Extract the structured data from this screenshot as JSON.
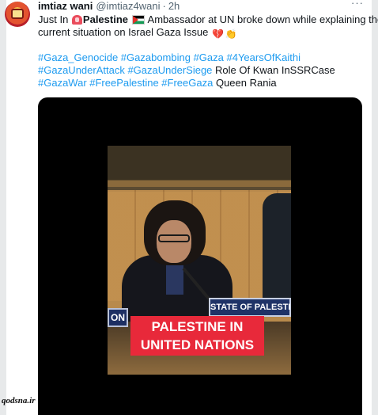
{
  "tweet": {
    "display_name": "imtiaz wani",
    "handle": "@imtiaz4wani",
    "separator": "·",
    "time": "2h",
    "more_label": "···",
    "line1_prefix": "Just In ",
    "line1_bold": "Palestine",
    "line1_suffix": " Ambassador at UN broke down while explaining the",
    "line2": "current situation on Israel Gaza Issue ",
    "hashtags_line1": "#Gaza_Genocide #Gazabombing #Gaza #4YearsOfKaithi",
    "hashtags_line2_tags": "#GazaUnderAttack #GazaUnderSiege",
    "hashtags_line2_text": " Role Of Kwan InSSRCase",
    "hashtags_line3_tags": "#GazaWar #FreePalestine #FreeGaza",
    "hashtags_line3_text": " Queen Rania",
    "hashtag_color": "#1d9bf0"
  },
  "icons": {
    "avatar": "profile-avatar",
    "alarm": "police-light-emoji",
    "flag": "palestine-flag-emoji",
    "heart": "broken-heart-emoji",
    "hands": "clapping-hands-emoji"
  },
  "media": {
    "nameplate_left": "ON",
    "nameplate": "STATE OF PALESTINE",
    "caption_line1": "PALESTINE IN",
    "caption_line2": "UNITED NATIONS"
  },
  "watermark": "qodsna.ir"
}
